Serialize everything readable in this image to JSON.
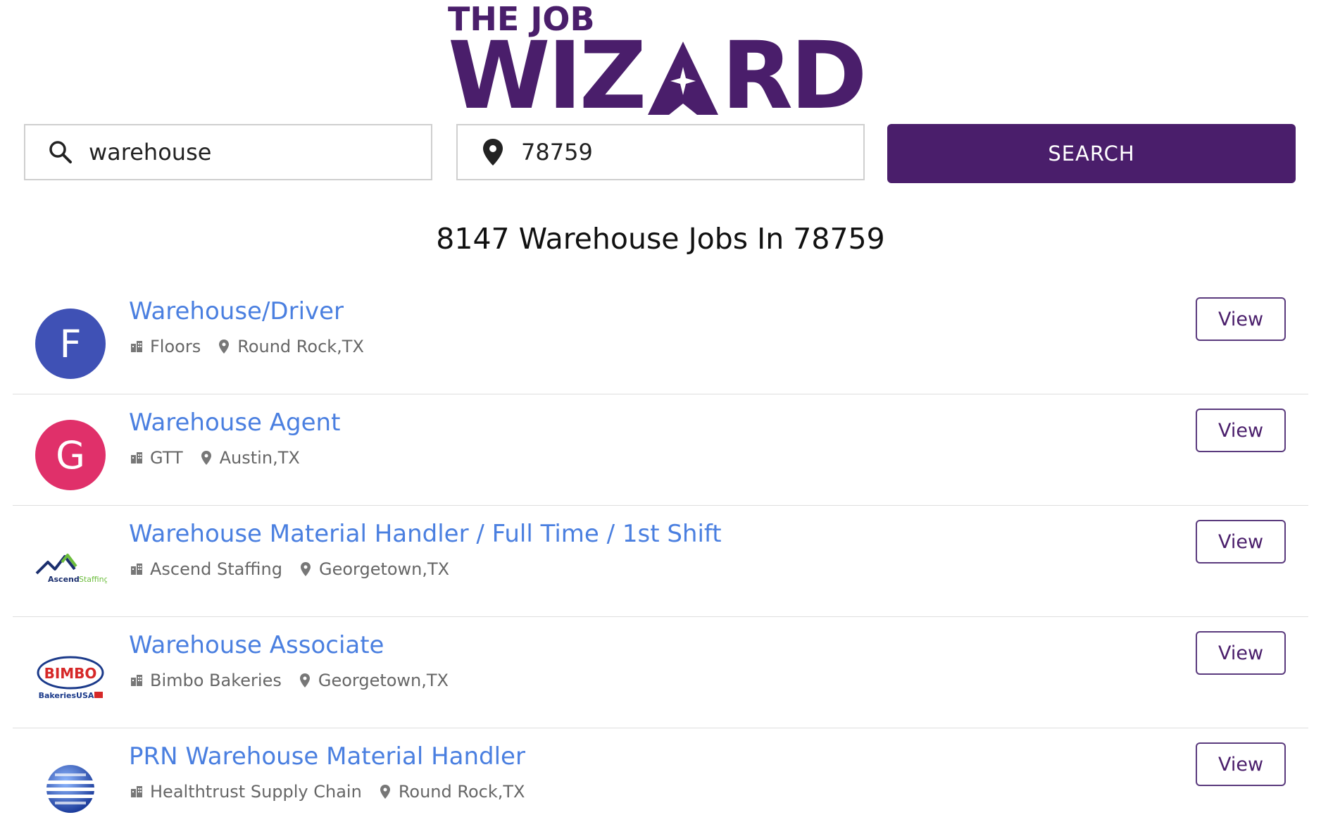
{
  "brand": {
    "line1": "THE JOB",
    "line2_before": "WIZ",
    "line2_after": "RD",
    "color": "#4a1e6b"
  },
  "search": {
    "keyword_value": "warehouse",
    "location_value": "78759",
    "button_label": "SEARCH",
    "keyword_icon": "search-icon",
    "location_icon": "map-pin-icon"
  },
  "results": {
    "heading": "8147 Warehouse Jobs In 78759"
  },
  "jobs": [
    {
      "title": "Warehouse/Driver",
      "company": "Floors",
      "location": "Round Rock,TX",
      "logo_type": "letter",
      "letter": "F",
      "avatar_color": "#3f51b5",
      "view_label": "View"
    },
    {
      "title": "Warehouse Agent",
      "company": "GTT",
      "location": "Austin,TX",
      "logo_type": "letter",
      "letter": "G",
      "avatar_color": "#e0306a",
      "view_label": "View"
    },
    {
      "title": "Warehouse Material Handler / Full Time / 1st Shift",
      "company": "Ascend Staffing",
      "location": "Georgetown,TX",
      "logo_type": "ascend",
      "logo_text_a": "Ascend",
      "logo_text_b": "Staffing",
      "view_label": "View"
    },
    {
      "title": "Warehouse Associate",
      "company": "Bimbo Bakeries",
      "location": "Georgetown,TX",
      "logo_type": "bimbo",
      "logo_text_a": "BIMBO",
      "logo_text_b": "BakeriesUSA",
      "view_label": "View"
    },
    {
      "title": "PRN Warehouse Material Handler",
      "company": "Healthtrust Supply Chain",
      "location": "Round Rock,TX",
      "logo_type": "globe",
      "view_label": "View"
    }
  ],
  "colors": {
    "link": "#4a7fe0",
    "accent": "#4a1e6b",
    "meta": "#666666"
  }
}
